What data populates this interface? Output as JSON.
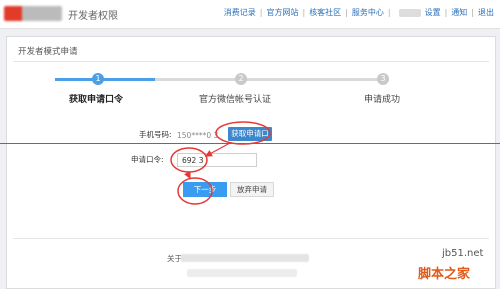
{
  "header": {
    "title": "开发者权限",
    "nav": [
      "消费记录",
      "官方网站",
      "核客社区",
      "服务中心",
      "设置",
      "通知",
      "退出"
    ]
  },
  "panel": {
    "title": "开发者模式申请"
  },
  "steps": [
    {
      "num": "1",
      "label": "获取申请口令",
      "active": true
    },
    {
      "num": "2",
      "label": "官方微信帐号认证",
      "active": false
    },
    {
      "num": "3",
      "label": "申请成功",
      "active": false
    }
  ],
  "form": {
    "phone_label": "手机号码:",
    "phone_value": "150****0 3",
    "get_code_button": "获取申请口令",
    "code_label": "申请口令:",
    "code_value": "692 3",
    "next_button": "下一步",
    "abandon_button": "放弃申请"
  },
  "footer": {
    "about": "关于"
  },
  "watermark": {
    "site": "jb51.net",
    "brand": "脚本之家"
  },
  "colors": {
    "accent": "#3a9cf0",
    "annotation": "#e53935"
  }
}
